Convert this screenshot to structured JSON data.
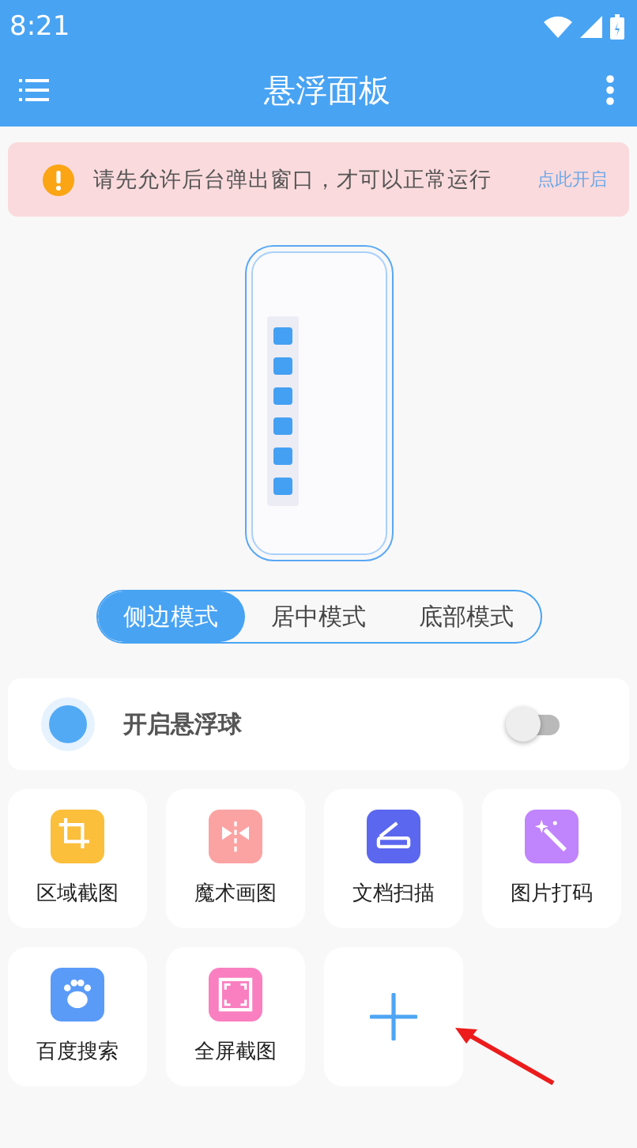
{
  "status_bar": {
    "time": "8:21"
  },
  "app_bar": {
    "title": "悬浮面板"
  },
  "notice": {
    "message": "请先允许后台弹出窗口，才可以正常运行",
    "action": "点此开启"
  },
  "modes": [
    {
      "label": "侧边模式",
      "selected": true
    },
    {
      "label": "居中模式",
      "selected": false
    },
    {
      "label": "底部模式",
      "selected": false
    }
  ],
  "float_ball": {
    "label": "开启悬浮球",
    "on": false
  },
  "tools": [
    {
      "label": "区域截图",
      "kind": "crop",
      "color": "#fbbf3c"
    },
    {
      "label": "魔术画图",
      "kind": "mirror",
      "color": "#fba3a3"
    },
    {
      "label": "文档扫描",
      "kind": "scan",
      "color": "#5b67ee"
    },
    {
      "label": "图片打码",
      "kind": "wand",
      "color": "#c084fc"
    },
    {
      "label": "百度搜索",
      "kind": "paw",
      "color": "#5b9bf8"
    },
    {
      "label": "全屏截图",
      "kind": "fullscreen",
      "color": "#f97fc0"
    },
    {
      "kind": "add"
    }
  ]
}
